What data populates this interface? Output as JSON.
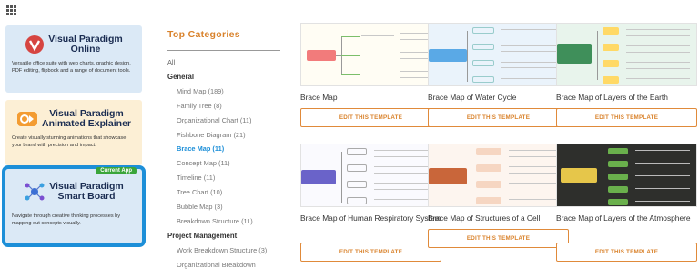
{
  "apps": [
    {
      "name": "Visual Paradigm",
      "sub": "Online",
      "desc": "Versatile office suite with web charts, graphic design, PDF editing, flipbook and a range of document tools.",
      "icon": "visual-paradigm-online-logo-icon"
    },
    {
      "name": "Visual Paradigm",
      "sub": "Animated Explainer",
      "desc": "Create visually stunning animations that showcase your brand with precision and impact.",
      "icon": "animated-explainer-logo-icon"
    },
    {
      "name": "Visual Paradigm",
      "sub": "Smart Board",
      "desc": "Navigate through creative thinking processes by mapping out concepts visually.",
      "icon": "smart-board-logo-icon",
      "badge": "Current App"
    }
  ],
  "categories": {
    "title": "Top Categories",
    "all": "All",
    "groups": [
      {
        "label": "General",
        "items": [
          "Mind Map (189)",
          "Family Tree (8)",
          "Organizational Chart (11)",
          "Fishbone Diagram (21)",
          "Brace Map (11)",
          "Concept Map (11)",
          "Timeline (11)",
          "Tree Chart (10)",
          "Bubble Map (3)",
          "Breakdown Structure (11)"
        ]
      },
      {
        "label": "Project Management",
        "items": [
          "Work Breakdown Structure (3)",
          "Organizational Breakdown"
        ]
      }
    ],
    "active": "Brace Map (11)"
  },
  "templates": [
    {
      "title": "Brace Map",
      "button": "EDIT THIS TEMPLATE",
      "thumb": "brace-map"
    },
    {
      "title": "Brace Map of Water Cycle",
      "button": "EDIT THIS TEMPLATE",
      "thumb": "water-cycle",
      "thumb_label": "Brace Map of Water Cycle"
    },
    {
      "title": "Brace Map of Layers of the Earth",
      "button": "EDIT THIS TEMPLATE",
      "thumb": "layers-earth",
      "thumb_label": "Brace Map of Layers of the Earth"
    },
    {
      "title": "Brace Map of Human Respiratory System",
      "button": "EDIT THIS TEMPLATE",
      "thumb": "respiratory",
      "thumb_label": "Brace Map of Human Respiratory System"
    },
    {
      "title": "Brace Map of Structures of a Cell",
      "button": "EDIT THIS TEMPLATE",
      "thumb": "cell",
      "thumb_label": "Brace Map of Structures of a Cell"
    },
    {
      "title": "Brace Map of Layers of the Atmosphere",
      "button": "EDIT THIS TEMPLATE",
      "thumb": "atmosphere",
      "thumb_label": "Brace Map of Layers of the Atmosphere"
    }
  ],
  "colors": {
    "accent": "#d9822b",
    "link": "#1d8fd8",
    "badge": "#3aa53a",
    "card_blue": "#dbe9f6",
    "card_yellow": "#fcefd5"
  }
}
